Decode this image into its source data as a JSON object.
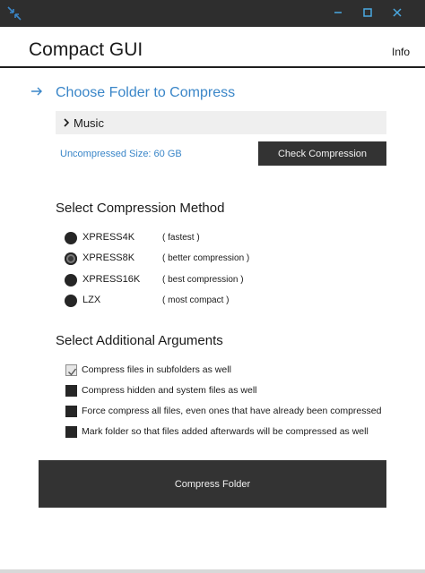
{
  "window": {
    "app_icon": "compress-arrows-icon",
    "minimize_icon": "minimize-icon",
    "maximize_icon": "maximize-icon",
    "close_icon": "close-icon"
  },
  "header": {
    "title": "Compact GUI",
    "info_link": "Info"
  },
  "choose_folder": {
    "icon": "arrow-right-icon",
    "title": "Choose Folder to Compress",
    "folder_name": "Music",
    "uncompressed_size": "Uncompressed Size: 60 GB",
    "check_button": "Check Compression"
  },
  "compression_method": {
    "title": "Select Compression Method",
    "options": [
      {
        "name": "XPRESS4K",
        "desc": "( fastest )",
        "selected": false
      },
      {
        "name": "XPRESS8K",
        "desc": "( better compression )",
        "selected": true
      },
      {
        "name": "XPRESS16K",
        "desc": "( best compression )",
        "selected": false
      },
      {
        "name": "LZX",
        "desc": "( most compact )",
        "selected": false
      }
    ]
  },
  "arguments": {
    "title": "Select Additional Arguments",
    "options": [
      {
        "label": "Compress files in subfolders as well",
        "checked": true
      },
      {
        "label": "Compress hidden and system files as well",
        "checked": false
      },
      {
        "label": "Force compress all files, even ones that have already been compressed",
        "checked": false
      },
      {
        "label": "Mark folder so that files added afterwards will be compressed as well",
        "checked": false
      }
    ]
  },
  "actions": {
    "compress_button": "Compress Folder"
  },
  "colors": {
    "accent": "#3a86c8",
    "titlebar": "#2e2e2e",
    "button": "#333333"
  }
}
